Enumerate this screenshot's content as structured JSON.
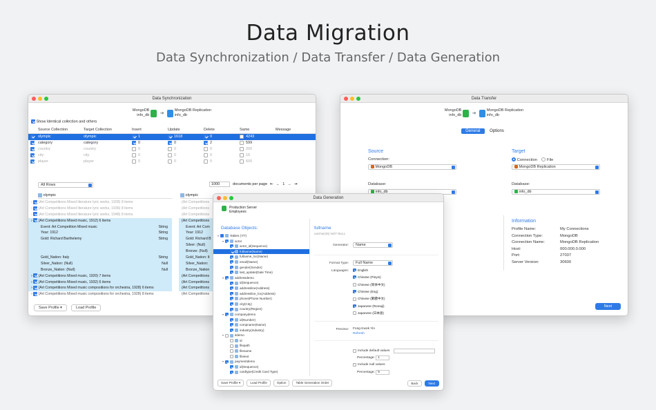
{
  "hero": {
    "title": "Data Migration",
    "subtitle": "Data Synchronization / Data Transfer / Data Generation"
  },
  "sync": {
    "window_title": "Data Synchronization",
    "source_name": "MongoDB",
    "source_db": "info_db",
    "target_name": "MongoDB Replication",
    "target_db": "info_db",
    "show_identical": "Show Identical collection and others",
    "columns": [
      "Source Collection",
      "Target Collection",
      "Insert",
      "Update",
      "Delete",
      "Same",
      "Message"
    ],
    "rows": [
      {
        "source": "olympic",
        "target": "olympic",
        "insert": "1",
        "update": "1618",
        "delete": "0",
        "same": "4243",
        "selected": true,
        "dim": false
      },
      {
        "source": "category",
        "target": "category",
        "insert": "0",
        "update": "0",
        "delete": "2",
        "same": "599",
        "selected": false,
        "dim": false
      },
      {
        "source": "country",
        "target": "country",
        "insert": "0",
        "update": "0",
        "delete": "0",
        "same": "200",
        "selected": false,
        "dim": true
      },
      {
        "source": "city",
        "target": "city",
        "insert": "0",
        "update": "0",
        "delete": "0",
        "same": "16",
        "selected": false,
        "dim": true
      },
      {
        "source": "player",
        "target": "player",
        "insert": "0",
        "update": "0",
        "delete": "0",
        "same": "600",
        "selected": false,
        "dim": true
      }
    ],
    "filter": "All Rows",
    "page_size": "1000",
    "docs_per_page": "documents per page",
    "page": "1",
    "left_tree_title": "olympic",
    "right_tree_title": "olympic",
    "left_tree": [
      {
        "text": "(Art Competitions Mixed literature lyric works, 1928) 8 items",
        "val": "",
        "style": "dim"
      },
      {
        "text": "(Art Competitions Mixed literature lyric works, 1936) 8 items",
        "val": "",
        "style": "dim"
      },
      {
        "text": "(Art Competitions Mixed literature lyric works, 1948) 8 items",
        "val": "",
        "style": "dim"
      },
      {
        "text": "(Art Competitions Mixed music, 1912) 6 items",
        "val": "",
        "style": "hl"
      },
      {
        "text": "Event: Art Competition Mixed music",
        "val": "String",
        "style": "hl"
      },
      {
        "text": "Year: 1912",
        "val": "String",
        "style": "hl"
      },
      {
        "text": "Gold: Richard Barthelemy",
        "val": "String",
        "style": "hl"
      },
      {
        "text": "",
        "val": "",
        "style": "hl"
      },
      {
        "text": "",
        "val": "",
        "style": "hl"
      },
      {
        "text": "Gold_Nation: Italy",
        "val": "String",
        "style": "hl"
      },
      {
        "text": "Silver_Nation: (Null)",
        "val": "Null",
        "style": "hl"
      },
      {
        "text": "Bronze_Nation: (Null)",
        "val": "Null",
        "style": "hl"
      },
      {
        "text": "(Art Competitions Mixed music, 1920) 7 items",
        "val": "",
        "style": "hl"
      },
      {
        "text": "(Art Competitions Mixed music, 1932) 6 items",
        "val": "",
        "style": "hl"
      },
      {
        "text": "(Art Competitions Mixed music compositions for orchestra, 1928) 6 items",
        "val": "",
        "style": "hl"
      },
      {
        "text": "(Art Competitions Mixed music compositions for orchestra, 1928) 8 items",
        "val": "",
        "style": ""
      }
    ],
    "right_tree": [
      {
        "text": "(Art Competitions",
        "style": "dim"
      },
      {
        "text": "(Art Competitions",
        "style": "dim"
      },
      {
        "text": "(Art Competitions",
        "style": "dim"
      },
      {
        "text": "(Art Competitions",
        "style": "hl"
      },
      {
        "text": "Event: Art Com",
        "style": "hl"
      },
      {
        "text": "Year: 1912",
        "style": "hl"
      },
      {
        "text": "Gold: Richard B",
        "style": "hl"
      },
      {
        "text": "Silver: (Null)",
        "style": "hl"
      },
      {
        "text": "Bronze: (Null)",
        "style": "hl"
      },
      {
        "text": "Gold_Nation: It",
        "style": "hl"
      },
      {
        "text": "Silver_Nation:",
        "style": "hl"
      },
      {
        "text": "Bronze_Nation",
        "style": "hl"
      },
      {
        "text": "(Art Competitions",
        "style": "hl"
      },
      {
        "text": "(Art Competitions",
        "style": "hl"
      },
      {
        "text": "(Art Competitions",
        "style": "hl"
      },
      {
        "text": "(Art Competitions",
        "style": ""
      }
    ],
    "save_profile": "Save Profile",
    "load_profile": "Load Profile"
  },
  "xfer": {
    "window_title": "Data Transfer",
    "source_name": "MongoDB",
    "source_db": "info_db",
    "target_name": "MongoDB Replication",
    "target_db": "info_db",
    "tab_general": "General",
    "tab_options": "Options",
    "source_title": "Source",
    "target_title": "Target",
    "connection_label": "Connection:",
    "radio_connection": "Connection",
    "radio_file": "File",
    "source_connection": "MongoDB",
    "target_connection": "MongoDB Replication",
    "database_label": "Database:",
    "source_database": "info_db",
    "target_database": "info_db",
    "info_title": "Information",
    "info": [
      {
        "k": "Profile Name:",
        "v": "My Connections"
      },
      {
        "k": "Connection Type:",
        "v": "MongoDB"
      },
      {
        "k": "Connection Name:",
        "v": "MongoDB Replication"
      },
      {
        "k": "Host:",
        "v": "000.000.0.000"
      },
      {
        "k": "Port:",
        "v": "27037"
      },
      {
        "k": "Server Version:",
        "v": "30600"
      }
    ],
    "next": "Next"
  },
  "gen": {
    "window_title": "Data Generation",
    "server": "Production Server",
    "db": "Employees",
    "objects_title": "Database Objects:",
    "tree": [
      {
        "text": "Tables (7/7)",
        "lvl": 0,
        "chk": "part",
        "tw": "▾",
        "sel": false
      },
      {
        "text": "actor",
        "lvl": 1,
        "chk": "on",
        "tw": "▾",
        "sel": false
      },
      {
        "text": "actor_id(Sequence)",
        "lvl": 2,
        "chk": "on",
        "tw": "",
        "sel": false
      },
      {
        "text": "fullname(Name)",
        "lvl": 2,
        "chk": "on",
        "tw": "",
        "sel": true
      },
      {
        "text": "fullname_loc(Name)",
        "lvl": 2,
        "chk": "on",
        "tw": "",
        "sel": false
      },
      {
        "text": "email(Name)",
        "lvl": 2,
        "chk": "on",
        "tw": "",
        "sel": false
      },
      {
        "text": "gender(Gender)",
        "lvl": 2,
        "chk": "on",
        "tw": "",
        "sel": false
      },
      {
        "text": "last_update(Date Time)",
        "lvl": 2,
        "chk": "on",
        "tw": "",
        "sel": false
      },
      {
        "text": "addressdemo",
        "lvl": 1,
        "chk": "on",
        "tw": "▾",
        "sel": false
      },
      {
        "text": "id(Sequence)",
        "lvl": 2,
        "chk": "on",
        "tw": "",
        "sel": false
      },
      {
        "text": "addressline(Address)",
        "lvl": 2,
        "chk": "on",
        "tw": "",
        "sel": false
      },
      {
        "text": "addressline_loc(Address)",
        "lvl": 2,
        "chk": "on",
        "tw": "",
        "sel": false
      },
      {
        "text": "phone(Phone Number)",
        "lvl": 2,
        "chk": "on",
        "tw": "",
        "sel": false
      },
      {
        "text": "city(City)",
        "lvl": 2,
        "chk": "on",
        "tw": "",
        "sel": false
      },
      {
        "text": "country(Region)",
        "lvl": 2,
        "chk": "on",
        "tw": "",
        "sel": false
      },
      {
        "text": "companydemo",
        "lvl": 1,
        "chk": "on",
        "tw": "▾",
        "sel": false
      },
      {
        "text": "id(Number)",
        "lvl": 2,
        "chk": "on",
        "tw": "",
        "sel": false
      },
      {
        "text": "compname(Name)",
        "lvl": 2,
        "chk": "on",
        "tw": "",
        "sel": false
      },
      {
        "text": "industry(Industry)",
        "lvl": 2,
        "chk": "on",
        "tw": "",
        "sel": false
      },
      {
        "text": "itdemo",
        "lvl": 1,
        "chk": "",
        "tw": "▾",
        "sel": false
      },
      {
        "text": "id",
        "lvl": 2,
        "chk": "",
        "tw": "",
        "sel": false
      },
      {
        "text": "filepath",
        "lvl": 2,
        "chk": "",
        "tw": "",
        "sel": false
      },
      {
        "text": "filename",
        "lvl": 2,
        "chk": "",
        "tw": "",
        "sel": false
      },
      {
        "text": "filetext",
        "lvl": 2,
        "chk": "",
        "tw": "",
        "sel": false
      },
      {
        "text": "paymentdemo",
        "lvl": 1,
        "chk": "on",
        "tw": "▾",
        "sel": false
      },
      {
        "text": "id(Sequence)",
        "lvl": 2,
        "chk": "on",
        "tw": "",
        "sel": false
      },
      {
        "text": "cardtype(Credit Card Type)",
        "lvl": 2,
        "chk": "on",
        "tw": "",
        "sel": false
      }
    ],
    "field_name": "fullname",
    "field_type": "varchar(45) NOT NULL",
    "generator_label": "Generator:",
    "generator": "Name",
    "format_label": "Format Type:",
    "format": "Full Name",
    "languages_label": "Languages:",
    "languages": [
      {
        "name": "English",
        "on": true
      },
      {
        "name": "Chinese (Pinyin)",
        "on": true
      },
      {
        "name": "Chinese (简体中文)",
        "on": false
      },
      {
        "name": "Chinese (Eng)",
        "on": true
      },
      {
        "name": "Chinese (繁體中文)",
        "on": false
      },
      {
        "name": "Japanese (Romaji)",
        "on": true
      },
      {
        "name": "Japanese (日本語)",
        "on": false
      }
    ],
    "preview_label": "Preview:",
    "preview": "Fong Kwok Yin",
    "refresh": "Refresh",
    "include_default": "Include default values",
    "percentage_label": "Percentage:",
    "pct1": "1",
    "include_null": "Include null values",
    "pct2": "5",
    "save_profile": "Save Profile",
    "load_profile": "Load Profile",
    "option": "Option",
    "table_order": "Table Generation Order",
    "back": "Back",
    "next": "Next"
  }
}
